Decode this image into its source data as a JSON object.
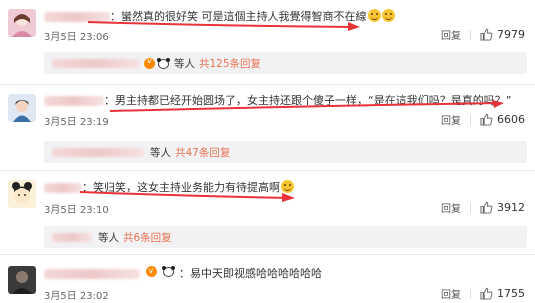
{
  "comments": [
    {
      "text": "蠻然真的很好笑 可是這個主持人我覺得智商不在線",
      "time": "3月5日 23:06",
      "reply_label": "回复",
      "likes": "7979",
      "sub": {
        "others": "等人",
        "count_link": "共125条回复"
      }
    },
    {
      "text": "男主持都已经开始圆场了，女主持还跟个傻子一样，“是在這我们吗？是真的吗？”",
      "time": "3月5日 23:19",
      "reply_label": "回复",
      "likes": "6606",
      "sub": {
        "others": "等人",
        "count_link": "共47条回复"
      }
    },
    {
      "text": "笑归笑，这女主持业务能力有待提高啊",
      "time": "3月5日 23:10",
      "reply_label": "回复",
      "likes": "3912",
      "sub": {
        "others": "等人",
        "count_link": "共6条回复"
      }
    },
    {
      "text": "易中天即视感哈哈哈哈哈哈",
      "time": "3月5日 23:02",
      "reply_label": "回复",
      "likes": "1755"
    }
  ],
  "colors": {
    "link": "#eb7350",
    "arrow": "#e8333b",
    "reply_bg": "#f2f2f5"
  },
  "icons": [
    "thumbs-up-icon",
    "panda-emoji-icon",
    "smile-emoji-icon",
    "vip-badge-icon"
  ]
}
